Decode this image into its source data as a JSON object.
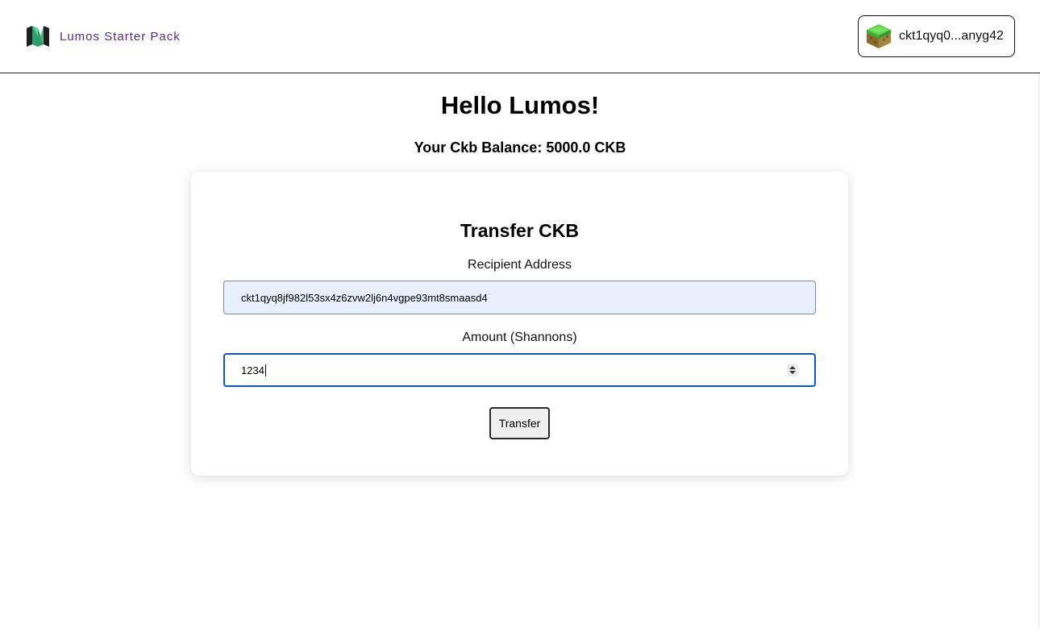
{
  "header": {
    "brand_name": "Lumos Starter Pack",
    "logo_icon": "lumos-logo-icon",
    "wallet": {
      "address_short": "ckt1qyq0...anyg42",
      "avatar_icon": "grass-block-avatar-icon"
    }
  },
  "main": {
    "title": "Hello Lumos!",
    "balance_text": "Your Ckb Balance: 5000.0 CKB"
  },
  "transfer_form": {
    "title": "Transfer CKB",
    "recipient_label": "Recipient Address",
    "recipient_value": "ckt1qyq8jf982l53sx4z6zvw2lj6n4vgpe93mt8smaasd4",
    "amount_label": "Amount (Shannons)",
    "amount_value": "1234",
    "submit_label": "Transfer"
  },
  "colors": {
    "brand_text": "#5b2a86",
    "autofill_bg": "#e8f0fe",
    "focus_border": "#0b57d0"
  }
}
